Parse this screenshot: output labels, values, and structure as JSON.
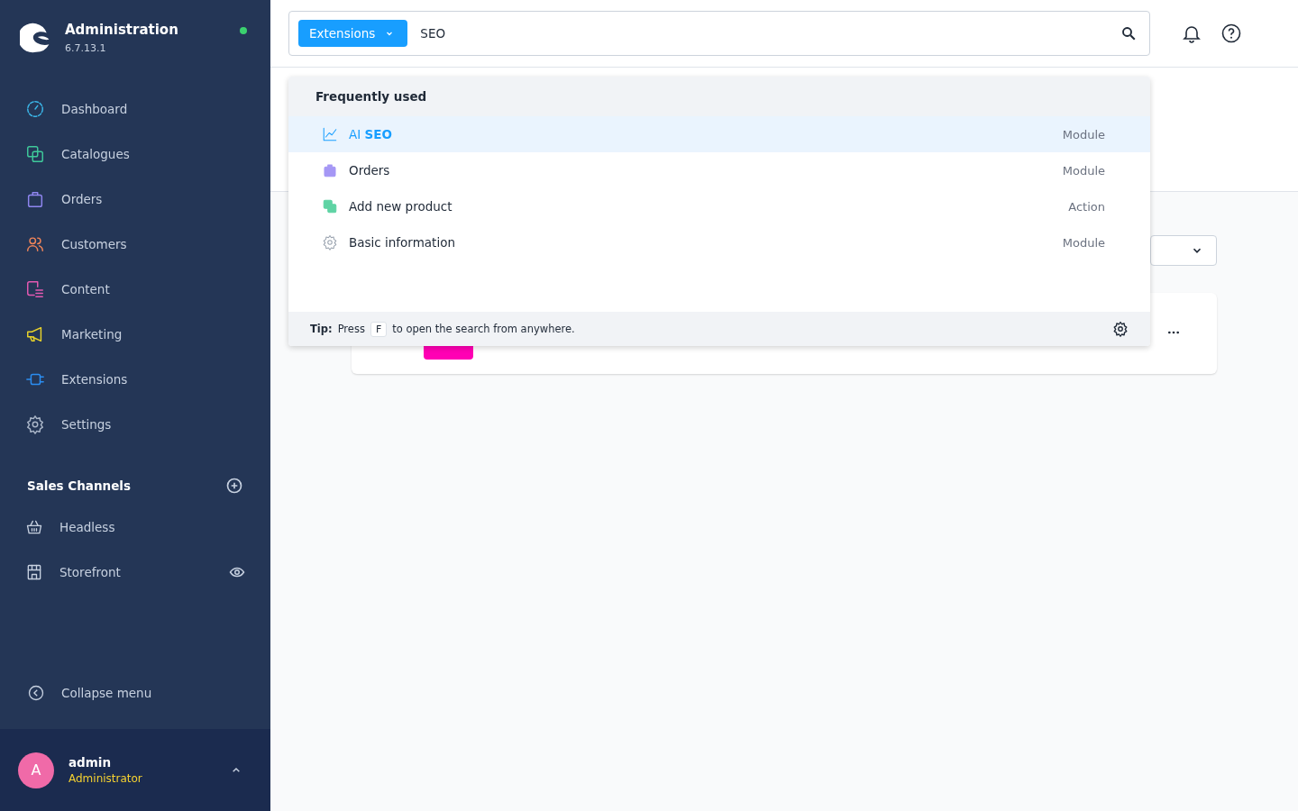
{
  "sidebar": {
    "title": "Administration",
    "version": "6.7.13.1",
    "online": true,
    "items": [
      {
        "label": "Dashboard",
        "kind": "gauge",
        "color": "#3bb6e8"
      },
      {
        "label": "Catalogues",
        "kind": "copies",
        "color": "#3fc99a"
      },
      {
        "label": "Orders",
        "kind": "bag",
        "color": "#8f86f0"
      },
      {
        "label": "Customers",
        "kind": "people",
        "color": "#f0855a"
      },
      {
        "label": "Content",
        "kind": "content",
        "color": "#e45ab3"
      },
      {
        "label": "Marketing",
        "kind": "megaphone",
        "color": "#e8d22a"
      },
      {
        "label": "Extensions",
        "kind": "plug",
        "color": "#2b8ef2"
      },
      {
        "label": "Settings",
        "kind": "gear",
        "color": "#aab6c8"
      }
    ],
    "sales_channels": {
      "title": "Sales Channels",
      "items": [
        {
          "label": "Headless",
          "kind": "basket",
          "visible_toggle": false
        },
        {
          "label": "Storefront",
          "kind": "store",
          "visible_toggle": true
        }
      ]
    },
    "collapse": "Collapse menu",
    "user": {
      "initial": "A",
      "name": "admin",
      "role": "Administrator"
    }
  },
  "search": {
    "scope": "Extensions",
    "value": "SEO"
  },
  "dropdown": {
    "heading": "Frequently used",
    "results": [
      {
        "title": "AI **SEO**",
        "type": "Module",
        "kind": "chart",
        "selected": true
      },
      {
        "title": "Orders",
        "type": "Module",
        "kind": "bag",
        "selected": false
      },
      {
        "title": "Add new product",
        "type": "Action",
        "kind": "copies",
        "selected": false
      },
      {
        "title": "Basic information",
        "type": "Module",
        "kind": "gear",
        "selected": false
      }
    ],
    "tip": {
      "label": "Tip:",
      "before": "Press",
      "key": "F",
      "after": "to open the search from anywhere."
    }
  }
}
